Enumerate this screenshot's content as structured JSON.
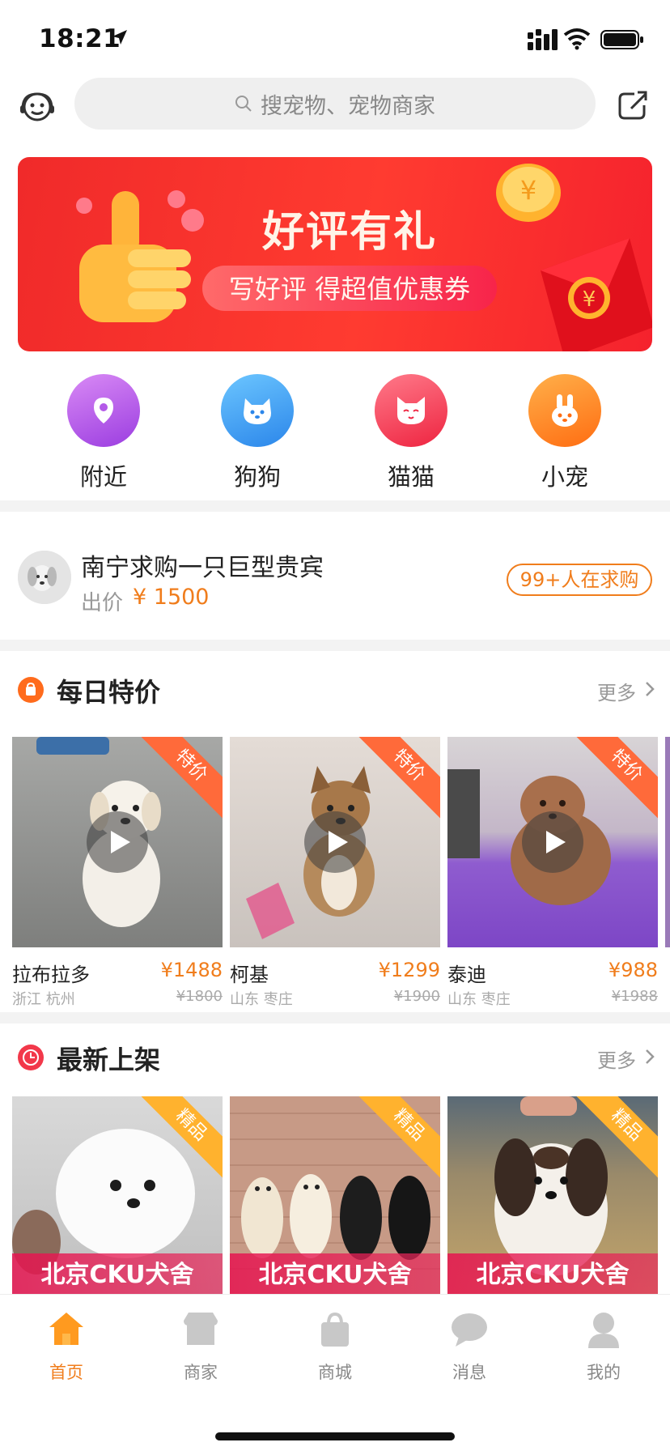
{
  "status_bar": {
    "time": "18:21"
  },
  "search": {
    "placeholder": "搜宠物、宠物商家"
  },
  "banner": {
    "title": "好评有礼",
    "subtitle": "写好评 得超值优惠券"
  },
  "categories": [
    {
      "label": "附近",
      "color": "#b45ae8",
      "icon": "location-icon"
    },
    {
      "label": "狗狗",
      "color": "#3a9cf0",
      "icon": "dog-icon"
    },
    {
      "label": "猫猫",
      "color": "#f3384f",
      "icon": "cat-icon"
    },
    {
      "label": "小宠",
      "color": "#ff8a1c",
      "icon": "rabbit-icon"
    }
  ],
  "request": {
    "title": "南宁求购一只巨型贵宾",
    "price_label": "出价",
    "price": "¥ 1500",
    "badge": "99+人在求购"
  },
  "daily_deals": {
    "title": "每日特价",
    "more": "更多",
    "ribbon": "特价",
    "items": [
      {
        "name": "拉布拉多",
        "price": "¥1488",
        "location": "浙江 杭州",
        "old_price": "¥1800"
      },
      {
        "name": "柯基",
        "price": "¥1299",
        "location": "山东 枣庄",
        "old_price": "¥1900"
      },
      {
        "name": "泰迪",
        "price": "¥988",
        "location": "山东 枣庄",
        "old_price": "¥1988"
      }
    ]
  },
  "new_arrivals": {
    "title": "最新上架",
    "more": "更多",
    "ribbon": "精品",
    "items": [
      {
        "shop": "北京CKU犬舍"
      },
      {
        "shop": "北京CKU犬舍"
      },
      {
        "shop": "北京CKU犬舍"
      }
    ]
  },
  "tabs": [
    {
      "label": "首页",
      "active": true
    },
    {
      "label": "商家",
      "active": false
    },
    {
      "label": "商城",
      "active": false
    },
    {
      "label": "消息",
      "active": false
    },
    {
      "label": "我的",
      "active": false
    }
  ],
  "colors": {
    "accent": "#f07d1c",
    "banner_red": "#ff3b30"
  }
}
